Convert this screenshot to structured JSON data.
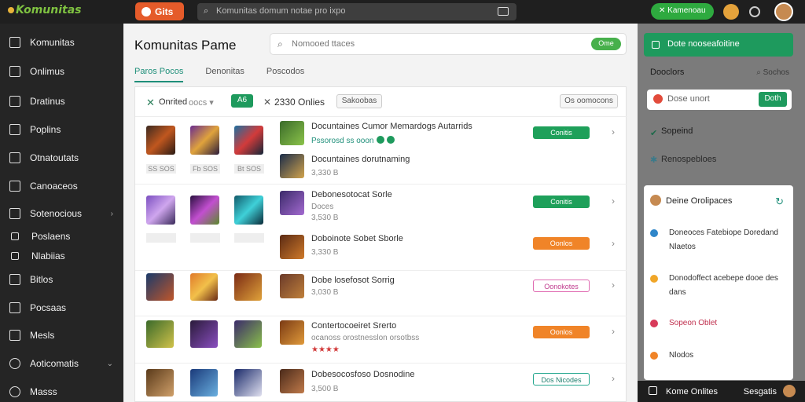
{
  "topbar": {
    "logo": "Komunitas",
    "brand_pill": "Gits",
    "search_placeholder": "Komunitas domum notae pro ixpo",
    "green_pill": "Kamenoau"
  },
  "sidebar": {
    "items": [
      {
        "label": "Komunitas",
        "icon": "grid-icon"
      },
      {
        "label": "Onlimus",
        "icon": "home-icon"
      },
      {
        "label": "Dratinus",
        "icon": "users-icon"
      },
      {
        "label": "Poplins",
        "icon": "chat-icon"
      },
      {
        "label": "Otnatoutats",
        "icon": "list-icon"
      },
      {
        "label": "Canoaceos",
        "icon": "wrench-icon"
      },
      {
        "label": "Sotenocious",
        "icon": "settings-icon",
        "chevron": true
      },
      {
        "label": "Poslaens",
        "icon": "person-icon"
      },
      {
        "label": "Nlabiias",
        "icon": "person-icon"
      },
      {
        "label": "Bitlos",
        "icon": "box-icon"
      },
      {
        "label": "Pocsaas",
        "icon": "folder-icon"
      },
      {
        "label": "Mesls",
        "icon": "doc-icon"
      },
      {
        "label": "Aoticomatis",
        "icon": "globe-icon",
        "chevron": true
      },
      {
        "label": "Masss",
        "icon": "person-icon"
      }
    ]
  },
  "main": {
    "title": "Komunitas Pame",
    "search_placeholder": "Nomooed ttaces",
    "search_button": "Ome",
    "tabs": [
      "Paros Pocos",
      "Denonitas",
      "Poscodos"
    ],
    "filter": {
      "label": "Onrited",
      "select": "oocs ▾",
      "badge": "A6",
      "count": "2330 Onlies",
      "chip": "Sakoobas",
      "right_chip": "Os oomocons"
    },
    "rows": [
      {
        "thumb_labels": [
          "SS SOS",
          "Fb SOS",
          "Bt SOS"
        ],
        "title": "Docuntaines Cumor Memardogs Autarrids",
        "sub": "Pssorosd ss ooon",
        "sub2": "Docuntaines dorutnaming",
        "sub3": "3,330 B",
        "status": "Conitis",
        "status_type": "green"
      },
      {
        "thumb_labels": [
          "",
          "",
          ""
        ],
        "title": "Debonesotocat Sorle",
        "sub": "Doces",
        "sub2": "3,530 B",
        "status": "Conitis",
        "status_type": "green",
        "title2": "Doboinote Sobet Sborle",
        "sub3": "3,330 B",
        "status2": "Oonlos",
        "status2_type": "orange"
      },
      {
        "thumb_labels": [
          "",
          "",
          ""
        ],
        "title": "Dobe losefosot Sorrig",
        "sub": "3,030 B",
        "status": "Oonokotes",
        "status_type": "pink"
      },
      {
        "thumb_labels": [
          "",
          "",
          ""
        ],
        "title": "Contertocoeiret Srerto",
        "sub": "ocanoss orostnesslon orsotbss",
        "status": "Oonlos",
        "status_type": "orange",
        "stars": "★★★★"
      },
      {
        "thumb_labels": [
          "",
          "",
          ""
        ],
        "title": "Dobesocosfoso Dosnodine",
        "sub": "3,500 B",
        "status": "Dos Nicodes",
        "status_type": "teal-outline"
      }
    ]
  },
  "right_panel": {
    "header": "Dote nooseafoitine",
    "sub_left": "Dooclors",
    "sub_right": "Sochos",
    "input_placeholder": "Dose unort",
    "input_button": "Doth",
    "links": [
      "Sopeind",
      "Renospebloes"
    ],
    "card_title": "Deine Orolipaces",
    "card_items": [
      {
        "text": "Doneoces Fatebiope Doredand Nlaetos",
        "color": "#2f86c9"
      },
      {
        "text": "Donodoffect acebepe dooe des dans",
        "color": "#f0a628"
      },
      {
        "text": "Sopeon Oblet",
        "color": "#d83a5a"
      },
      {
        "text": "Nlodos",
        "color": "#f08428"
      }
    ],
    "bottom_left": "Kome Onlites",
    "bottom_right": "Sesgatis"
  }
}
